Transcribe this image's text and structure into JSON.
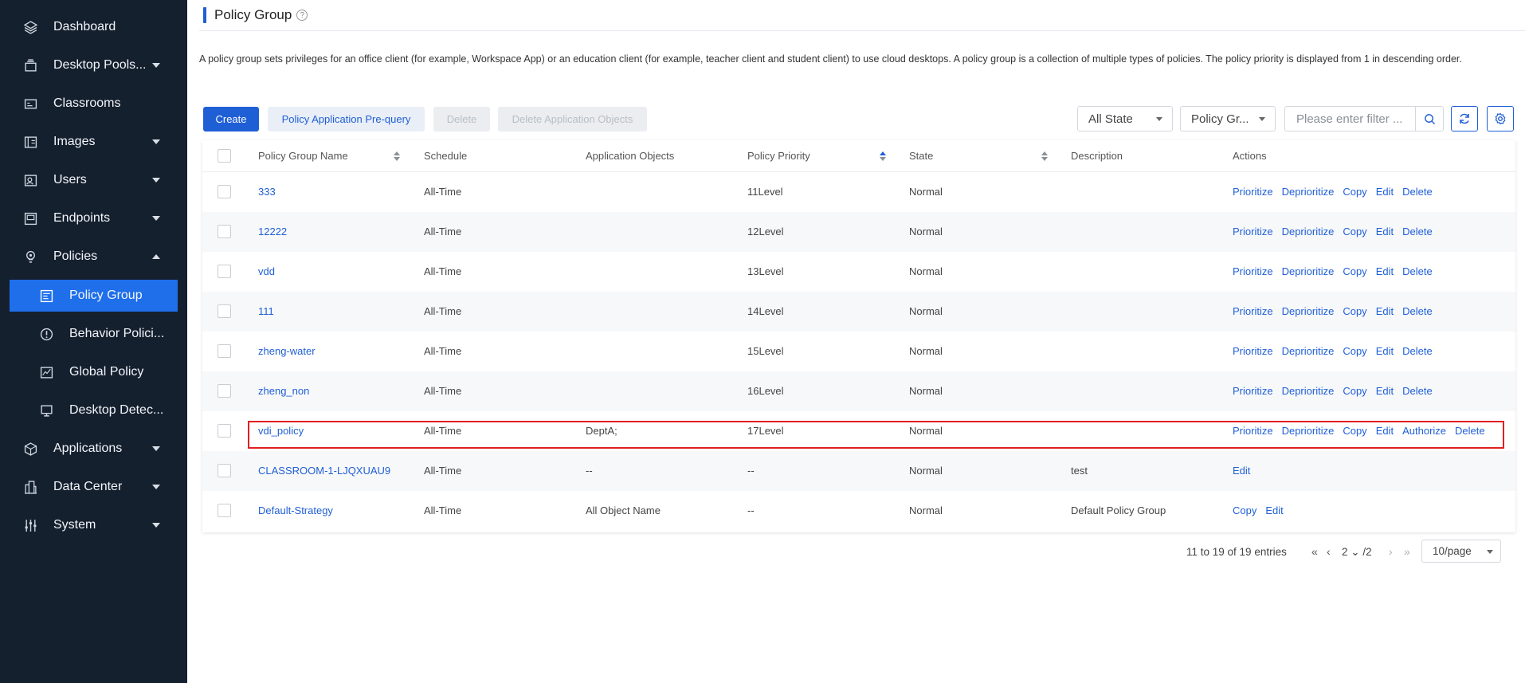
{
  "sidebar": {
    "items": [
      {
        "label": "Dashboard",
        "icon": "layers-icon"
      },
      {
        "label": "Desktop Pools...",
        "icon": "desktop-pools-icon"
      },
      {
        "label": "Classrooms",
        "icon": "classroom-icon"
      },
      {
        "label": "Images",
        "icon": "images-icon"
      },
      {
        "label": "Users",
        "icon": "users-icon"
      },
      {
        "label": "Endpoints",
        "icon": "endpoints-icon"
      },
      {
        "label": "Policies",
        "icon": "policies-icon"
      },
      {
        "label": "Policy Group",
        "icon": "policy-group-icon"
      },
      {
        "label": "Behavior Polici...",
        "icon": "behavior-policy-icon"
      },
      {
        "label": "Global Policy",
        "icon": "global-policy-icon"
      },
      {
        "label": "Desktop Detec...",
        "icon": "desktop-detect-icon"
      },
      {
        "label": "Applications",
        "icon": "applications-icon"
      },
      {
        "label": "Data Center",
        "icon": "data-center-icon"
      },
      {
        "label": "System",
        "icon": "system-icon"
      }
    ]
  },
  "header": {
    "title": "Policy Group",
    "help": "?",
    "description": "A policy group sets privileges for an office client (for example, Workspace App) or an education client (for example, teacher client and student client) to use cloud desktops. A policy group is a collection of multiple types of policies. The policy priority is displayed from 1 in descending order."
  },
  "toolbar": {
    "create": "Create",
    "prequery": "Policy Application Pre-query",
    "delete": "Delete",
    "delete_objects": "Delete Application Objects",
    "state_filter": "All State",
    "group_filter": "Policy Gr...",
    "filter_placeholder": "Please enter filter ..."
  },
  "table": {
    "headers": {
      "name": "Policy Group Name",
      "schedule": "Schedule",
      "objects": "Application Objects",
      "priority": "Policy Priority",
      "state": "State",
      "description": "Description",
      "actions": "Actions"
    },
    "rows": [
      {
        "name": "333",
        "schedule": "All-Time",
        "objects": "",
        "priority": "11Level",
        "state": "Normal",
        "description": "",
        "actions": [
          "Prioritize",
          "Deprioritize",
          "Copy",
          "Edit",
          "Delete"
        ]
      },
      {
        "name": "12222",
        "schedule": "All-Time",
        "objects": "",
        "priority": "12Level",
        "state": "Normal",
        "description": "",
        "actions": [
          "Prioritize",
          "Deprioritize",
          "Copy",
          "Edit",
          "Delete"
        ]
      },
      {
        "name": "vdd",
        "schedule": "All-Time",
        "objects": "",
        "priority": "13Level",
        "state": "Normal",
        "description": "",
        "actions": [
          "Prioritize",
          "Deprioritize",
          "Copy",
          "Edit",
          "Delete"
        ]
      },
      {
        "name": "111",
        "schedule": "All-Time",
        "objects": "",
        "priority": "14Level",
        "state": "Normal",
        "description": "",
        "actions": [
          "Prioritize",
          "Deprioritize",
          "Copy",
          "Edit",
          "Delete"
        ]
      },
      {
        "name": "zheng-water",
        "schedule": "All-Time",
        "objects": "",
        "priority": "15Level",
        "state": "Normal",
        "description": "",
        "actions": [
          "Prioritize",
          "Deprioritize",
          "Copy",
          "Edit",
          "Delete"
        ]
      },
      {
        "name": "zheng_non",
        "schedule": "All-Time",
        "objects": "",
        "priority": "16Level",
        "state": "Normal",
        "description": "",
        "actions": [
          "Prioritize",
          "Deprioritize",
          "Copy",
          "Edit",
          "Delete"
        ]
      },
      {
        "name": "vdi_policy",
        "schedule": "All-Time",
        "objects": "DeptA;",
        "priority": "17Level",
        "state": "Normal",
        "description": "",
        "actions": [
          "Prioritize",
          "Deprioritize",
          "Copy",
          "Edit",
          "Authorize",
          "Delete"
        ]
      },
      {
        "name": "CLASSROOM-1-LJQXUAU9",
        "schedule": "All-Time",
        "objects": "--",
        "priority": "--",
        "state": "Normal",
        "description": "test",
        "actions": [
          "Edit"
        ]
      },
      {
        "name": "Default-Strategy",
        "schedule": "All-Time",
        "objects": "All Object Name",
        "priority": "--",
        "state": "Normal",
        "description": "Default Policy Group",
        "actions": [
          "Copy",
          "Edit"
        ]
      }
    ]
  },
  "pagination": {
    "summary": "11 to 19 of 19 entries",
    "current": "2",
    "total": "/2",
    "page_size": "10/page"
  }
}
